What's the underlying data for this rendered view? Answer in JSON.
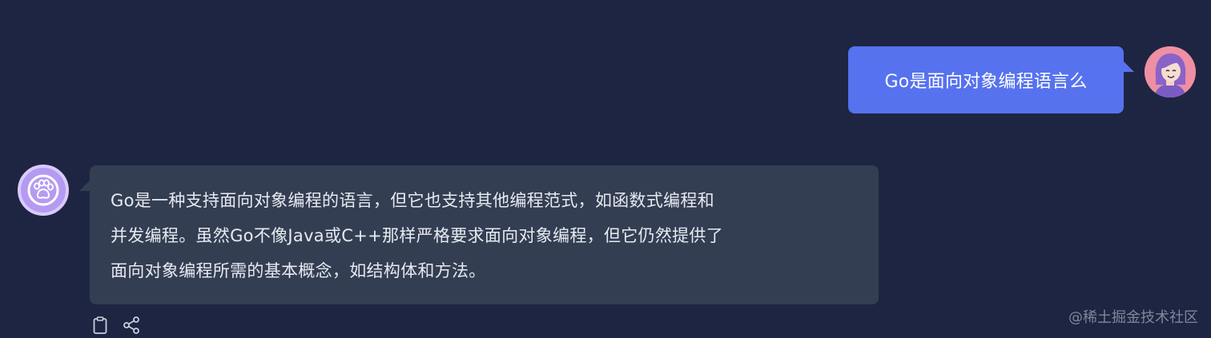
{
  "conversation": {
    "user_message": {
      "text": "Go是面向对象编程语言么",
      "avatar_icon": "user-avatar-icon"
    },
    "assistant_message": {
      "lines": [
        "Go是一种支持面向对象编程的语言，但它也支持其他编程范式，如函数式编程和",
        "并发编程。虽然Go不像Java或C++那样严格要求面向对象编程，但它仍然提供了",
        "面向对象编程所需的基本概念，如结构体和方法。"
      ],
      "avatar_icon": "paw-icon"
    }
  },
  "actions": [
    {
      "icon": "clipboard-icon"
    },
    {
      "icon": "share-icon"
    }
  ],
  "watermark": "@稀土掘金技术社区",
  "colors": {
    "background": "#1e2542",
    "user_bubble": "#5672ee",
    "assistant_bubble": "#343e52",
    "assistant_avatar": "#b49af3",
    "user_avatar": "#ef8fa4"
  }
}
